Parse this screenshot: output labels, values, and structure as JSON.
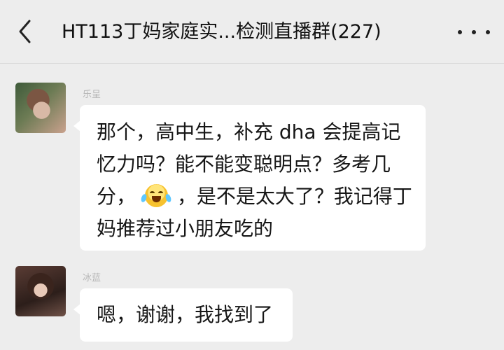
{
  "header": {
    "title": "HT113丁妈家庭实...检测直播群(227)",
    "back_icon": "chevron-left-icon",
    "more_icon": "more-dots-icon"
  },
  "messages": [
    {
      "sender": "乐呈",
      "avatar_icon": "avatar-image",
      "lines": [
        "那个，高中生，补充 dha 会提高记",
        "忆力吗？能不能变聪明点？多考几",
        "分，",
        "，是不是太大了？我记得丁",
        "妈推荐过小朋友吃的"
      ],
      "emoji_icon": "laughing-with-tears-icon"
    },
    {
      "sender": "冰蓝",
      "avatar_icon": "avatar-image",
      "lines": [
        "嗯，谢谢，我找到了"
      ]
    }
  ]
}
